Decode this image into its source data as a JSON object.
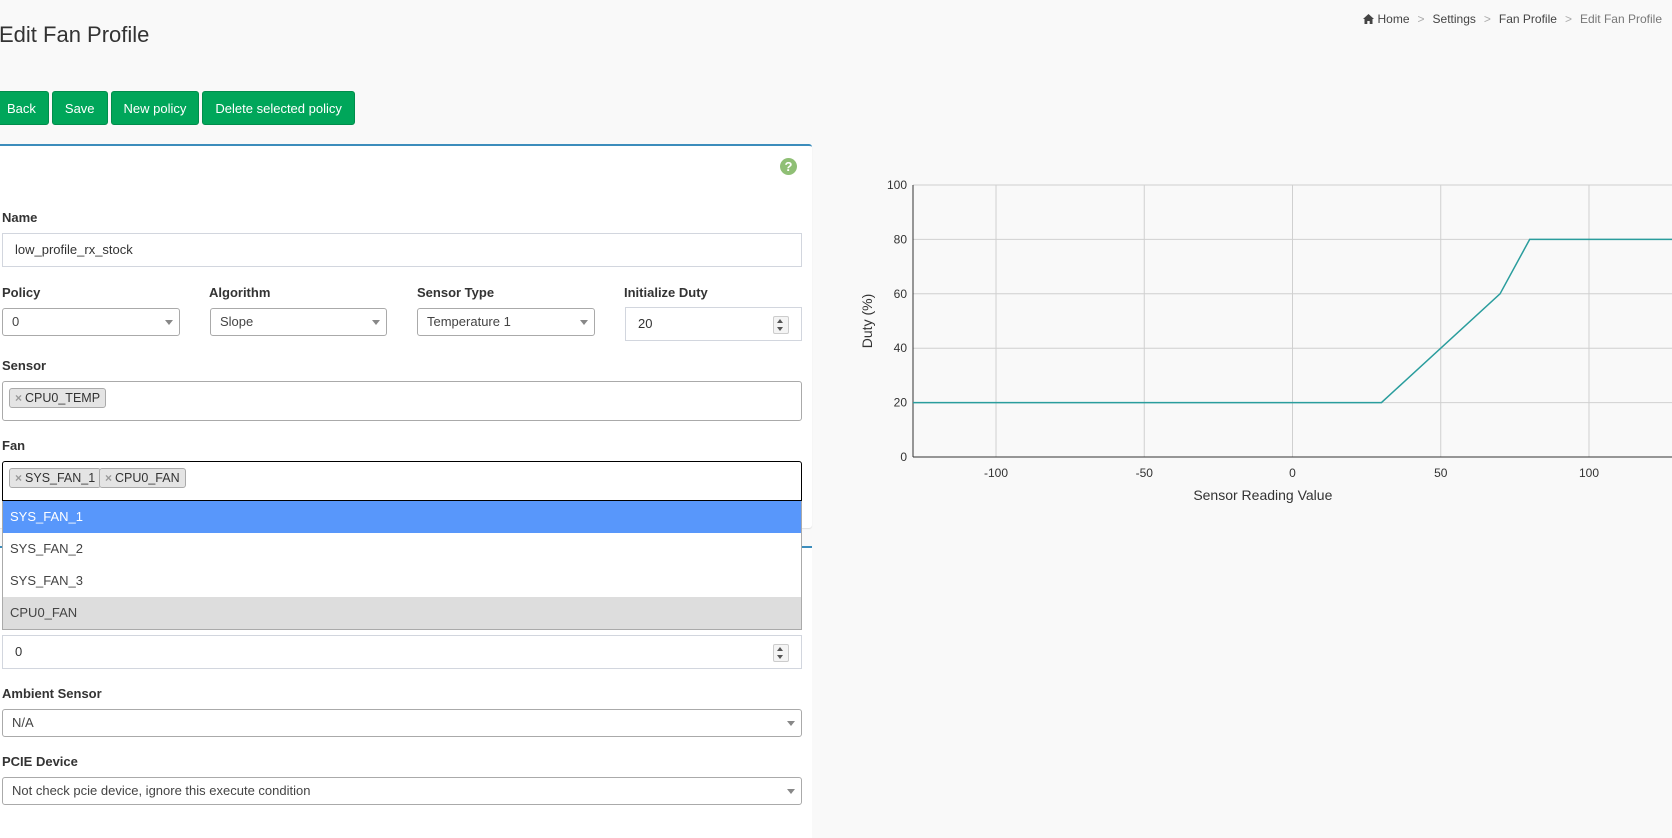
{
  "header": {
    "title": "Edit Fan Profile",
    "breadcrumb": [
      "Home",
      "Settings",
      "Fan Profile",
      "Edit Fan Profile"
    ]
  },
  "toolbar": {
    "back": "Back",
    "save": "Save",
    "new_policy": "New policy",
    "delete_policy": "Delete selected policy"
  },
  "form": {
    "help": "?",
    "name_label": "Name",
    "name_value": "low_profile_rx_stock",
    "policy_label": "Policy",
    "policy_value": "0",
    "algorithm_label": "Algorithm",
    "algorithm_value": "Slope",
    "sensor_type_label": "Sensor Type",
    "sensor_type_value": "Temperature 1",
    "init_duty_label": "Initialize Duty",
    "init_duty_value": "20",
    "sensor_label": "Sensor",
    "sensor_tags": [
      "CPU0_TEMP"
    ],
    "fan_label": "Fan",
    "fan_tags": [
      "SYS_FAN_1",
      "CPU0_FAN"
    ],
    "fan_options": [
      "SYS_FAN_1",
      "SYS_FAN_2",
      "SYS_FAN_3",
      "CPU0_FAN"
    ],
    "hidden_field_value": "0",
    "ambient_label": "Ambient Sensor",
    "ambient_value": "N/A",
    "pcie_label": "PCIE Device",
    "pcie_value": "Not check pcie device, ignore this execute condition"
  },
  "chart_data": {
    "type": "line",
    "xlabel": "Sensor Reading Value",
    "ylabel": "Duty (%)",
    "xlim": [
      -128,
      128
    ],
    "ylim": [
      0,
      100
    ],
    "xticks": [
      -100,
      -50,
      0,
      50,
      100
    ],
    "yticks": [
      0,
      20,
      40,
      60,
      80,
      100
    ],
    "grid": true,
    "series": [
      {
        "x": [
          -128,
          30,
          70,
          80,
          128
        ],
        "y": [
          20,
          20,
          60,
          80,
          80
        ],
        "color": "#2a9d9d"
      }
    ]
  }
}
